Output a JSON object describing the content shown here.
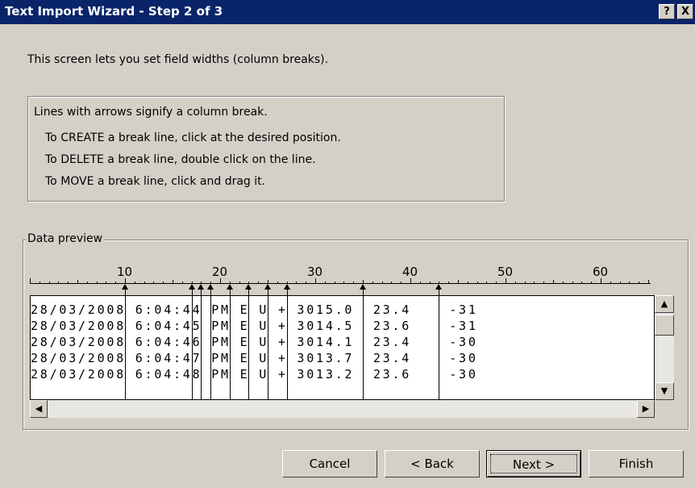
{
  "window": {
    "title": "Text Import Wizard - Step 2 of 3",
    "help_label": "?",
    "close_label": "X"
  },
  "intro": "This screen lets you set field widths (column breaks).",
  "info": {
    "line1": "Lines with arrows signify a column break.",
    "line2": "To CREATE a break line, click at the desired position.",
    "line3": "To DELETE a break line, double click on the line.",
    "line4": "To MOVE a break line, click and drag it."
  },
  "preview": {
    "group_label": "Data preview",
    "ruler_numbers": [
      "10",
      "20",
      "30",
      "40",
      "50",
      "60"
    ],
    "rows": [
      "28/03/2008 6:04:44 PM E U + 3015.0  23.4    -31",
      "28/03/2008 6:04:45 PM E U + 3014.5  23.6    -31",
      "28/03/2008 6:04:46 PM E U + 3014.1  23.4    -30",
      "28/03/2008 6:04:47 PM E U + 3013.7  23.4    -30",
      "28/03/2008 6:04:48 PM E U + 3013.2  23.6    -30"
    ],
    "break_columns": [
      10,
      17,
      18,
      19,
      21,
      23,
      25,
      27,
      35,
      43
    ]
  },
  "buttons": {
    "cancel": "Cancel",
    "back": "< Back",
    "next": "Next >",
    "finish": "Finish"
  }
}
